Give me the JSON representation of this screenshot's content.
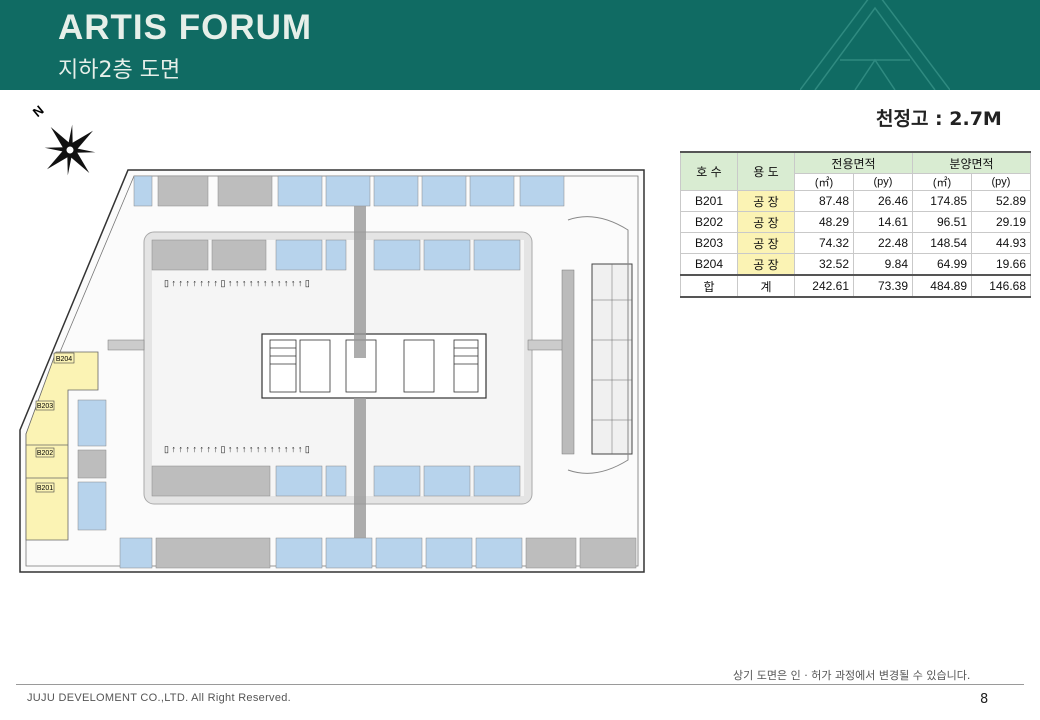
{
  "header": {
    "brand": "ARTIS FORUM",
    "subtitle": "지하2층 도면"
  },
  "ceiling": "천정고 : 2.7M",
  "plan": {
    "north": "N",
    "units": [
      "B204",
      "B203",
      "B202",
      "B201"
    ]
  },
  "table": {
    "col_ho": "호  수",
    "col_use": "용  도",
    "col_exclusive": "전용면적",
    "col_sale": "분양면적",
    "unit_m2": "(㎡)",
    "unit_py": "(py)",
    "rows": [
      {
        "unit": "B201",
        "use": "공 장",
        "ex_m2": "87.48",
        "ex_py": "26.46",
        "sale_m2": "174.85",
        "sale_py": "52.89"
      },
      {
        "unit": "B202",
        "use": "공 장",
        "ex_m2": "48.29",
        "ex_py": "14.61",
        "sale_m2": "96.51",
        "sale_py": "29.19"
      },
      {
        "unit": "B203",
        "use": "공 장",
        "ex_m2": "74.32",
        "ex_py": "22.48",
        "sale_m2": "148.54",
        "sale_py": "44.93"
      },
      {
        "unit": "B204",
        "use": "공 장",
        "ex_m2": "32.52",
        "ex_py": "9.84",
        "sale_m2": "64.99",
        "sale_py": "19.66"
      }
    ],
    "total": {
      "label_a": "합",
      "label_b": "계",
      "ex_m2": "242.61",
      "ex_py": "73.39",
      "sale_m2": "484.89",
      "sale_py": "146.68"
    }
  },
  "note": "상기 도면은 인 · 허가 과정에서 변경될 수 있습니다.",
  "footer": {
    "copyright": "JUJU DEVELOMENT CO.,LTD. All Right Reserved.",
    "page": "8"
  }
}
